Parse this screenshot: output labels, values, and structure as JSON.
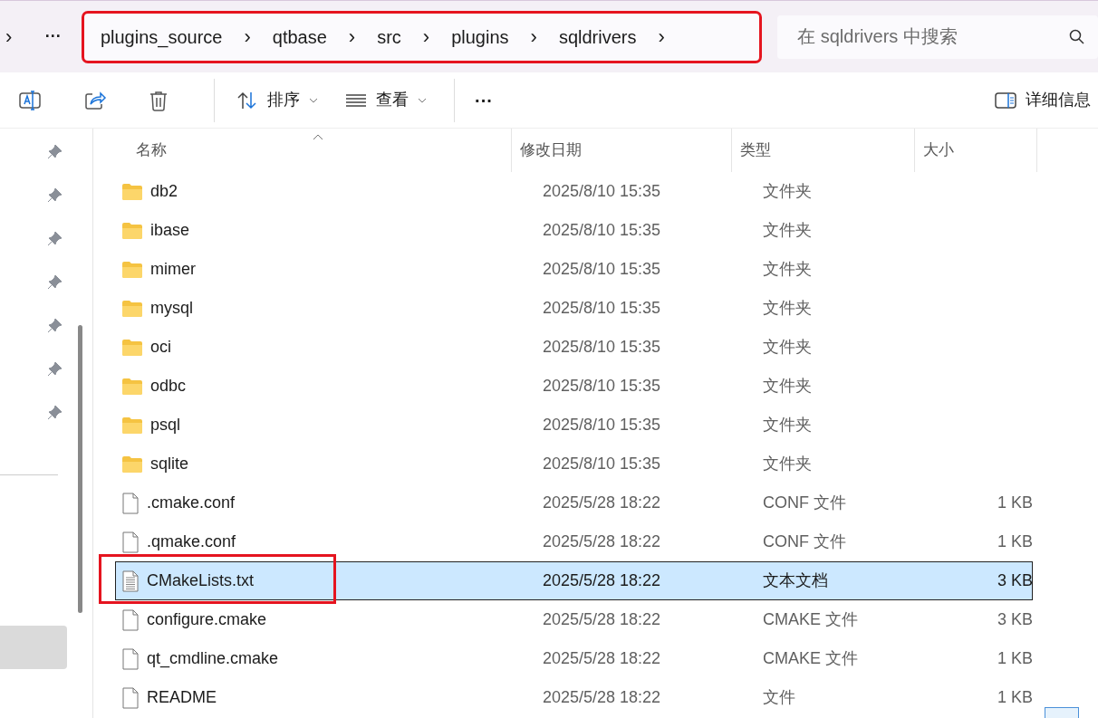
{
  "address_bar": {
    "expand": "›",
    "more": "···",
    "highlighted": true,
    "crumbs": [
      {
        "label": "plugins_source",
        "separator": "›"
      },
      {
        "label": "qtbase",
        "separator": "›"
      },
      {
        "label": "src",
        "separator": "›"
      },
      {
        "label": "plugins",
        "separator": "›"
      },
      {
        "label": "sqldrivers",
        "separator": "›"
      }
    ]
  },
  "search": {
    "placeholder": "在 sqldrivers 中搜索"
  },
  "toolbar": {
    "items": [
      {
        "kind": "rename"
      },
      {
        "kind": "share"
      },
      {
        "kind": "delete"
      },
      {
        "kind": "sort",
        "label": "排序"
      },
      {
        "kind": "view",
        "label": "查看"
      },
      {
        "kind": "more",
        "label": "···"
      }
    ],
    "details": "详细信息"
  },
  "sidebar": {
    "items": [
      {
        "pinned": true,
        "selected": false
      },
      {
        "pinned": true,
        "selected": false
      },
      {
        "pinned": true,
        "selected": false
      },
      {
        "pinned": true,
        "selected": false
      },
      {
        "pinned": true,
        "selected": false
      },
      {
        "pinned": true,
        "selected": false
      },
      {
        "pinned": true,
        "selected": false
      },
      {
        "pinned": false,
        "selected": true
      }
    ]
  },
  "table": {
    "columns": [
      "名称",
      "修改日期",
      "类型",
      "大小"
    ],
    "rows": [
      {
        "kind": "folder",
        "name": "db2",
        "date": "2025/8/10 15:35",
        "type": "文件夹",
        "selected": false,
        "highlighted": false
      },
      {
        "kind": "folder",
        "name": "ibase",
        "date": "2025/8/10 15:35",
        "type": "文件夹",
        "selected": false,
        "highlighted": false
      },
      {
        "kind": "folder",
        "name": "mimer",
        "date": "2025/8/10 15:35",
        "type": "文件夹",
        "selected": false,
        "highlighted": false
      },
      {
        "kind": "folder",
        "name": "mysql",
        "date": "2025/8/10 15:35",
        "type": "文件夹",
        "selected": false,
        "highlighted": false
      },
      {
        "kind": "folder",
        "name": "oci",
        "date": "2025/8/10 15:35",
        "type": "文件夹",
        "selected": false,
        "highlighted": false
      },
      {
        "kind": "folder",
        "name": "odbc",
        "date": "2025/8/10 15:35",
        "type": "文件夹",
        "selected": false,
        "highlighted": false
      },
      {
        "kind": "folder",
        "name": "psql",
        "date": "2025/8/10 15:35",
        "type": "文件夹",
        "selected": false,
        "highlighted": false
      },
      {
        "kind": "folder",
        "name": "sqlite",
        "date": "2025/8/10 15:35",
        "type": "文件夹",
        "selected": false,
        "highlighted": false
      },
      {
        "kind": "file",
        "name": ".cmake.conf",
        "date": "2025/5/28 18:22",
        "type": "CONF 文件",
        "size": "1 KB",
        "selected": false,
        "highlighted": false
      },
      {
        "kind": "file",
        "name": ".qmake.conf",
        "date": "2025/5/28 18:22",
        "type": "CONF 文件",
        "size": "1 KB",
        "selected": false,
        "highlighted": false
      },
      {
        "kind": "text",
        "name": "CMakeLists.txt",
        "date": "2025/5/28 18:22",
        "type": "文本文档",
        "size": "3 KB",
        "selected": true,
        "highlighted": true
      },
      {
        "kind": "file",
        "name": "configure.cmake",
        "date": "2025/5/28 18:22",
        "type": "CMAKE 文件",
        "size": "3 KB",
        "selected": false,
        "highlighted": false
      },
      {
        "kind": "file",
        "name": "qt_cmdline.cmake",
        "date": "2025/5/28 18:22",
        "type": "CMAKE 文件",
        "size": "1 KB",
        "selected": false,
        "highlighted": false
      },
      {
        "kind": "file",
        "name": "README",
        "date": "2025/5/28 18:22",
        "type": "文件",
        "size": "1 KB",
        "selected": false,
        "highlighted": false
      }
    ]
  }
}
